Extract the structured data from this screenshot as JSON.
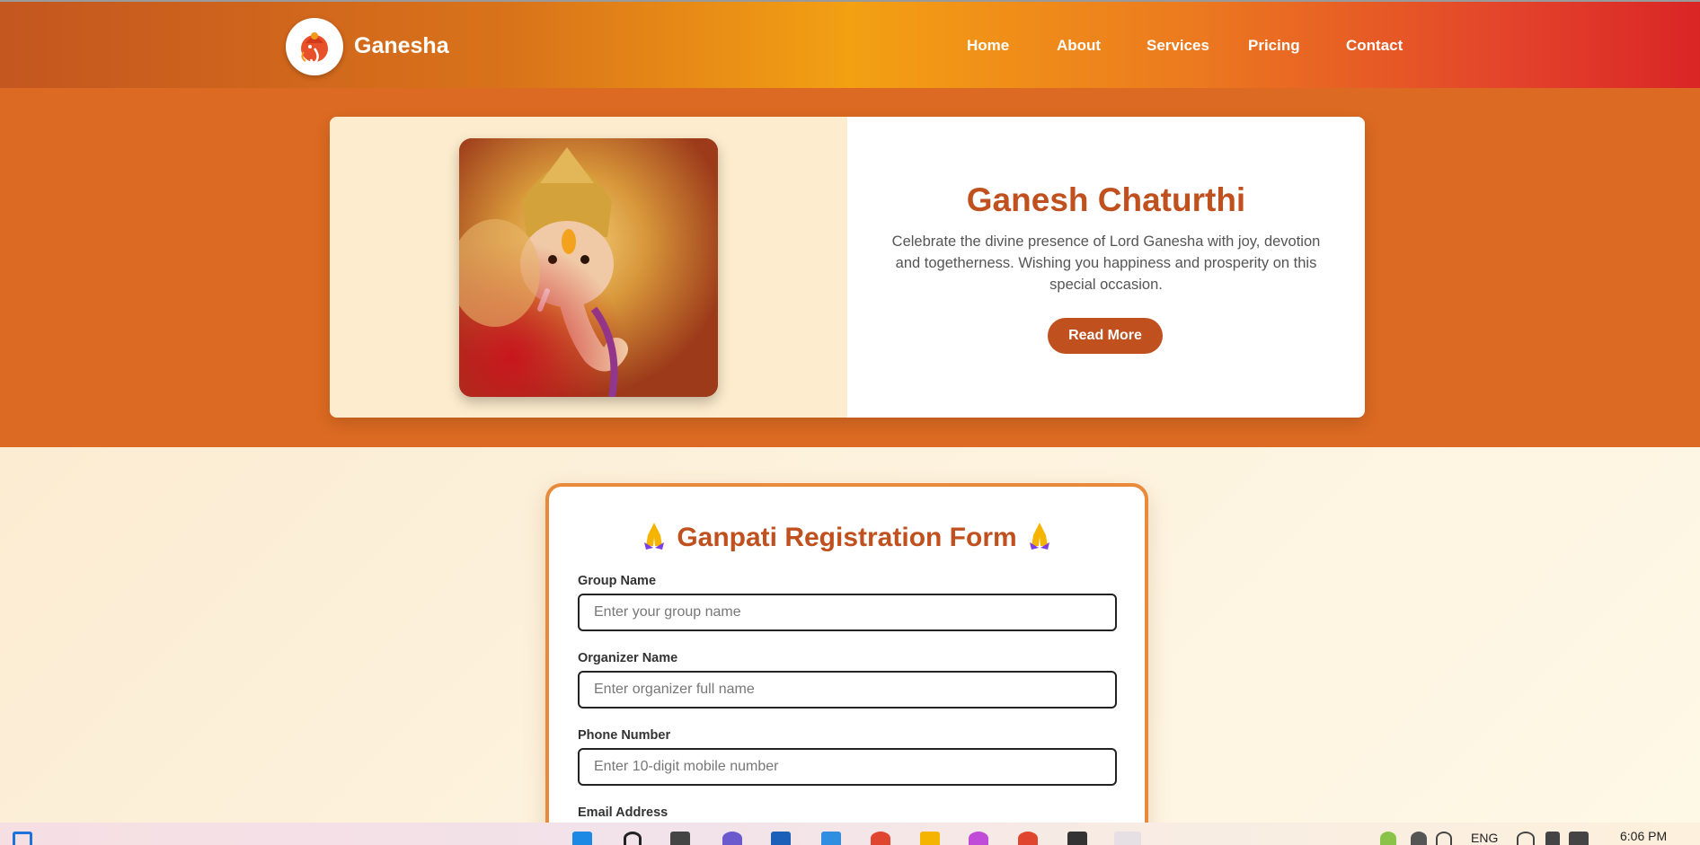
{
  "navbar": {
    "brand": "Ganesha",
    "links": [
      "Home",
      "About",
      "Services",
      "Pricing",
      "Contact"
    ]
  },
  "hero": {
    "title": "Ganesh Chaturthi",
    "text": "Celebrate the divine presence of Lord Ganesha with joy, devotion and togetherness. Wishing you happiness and prosperity on this special occasion.",
    "button": "Read More"
  },
  "form": {
    "title": "Ganpati Registration Form",
    "fields": [
      {
        "label": "Group Name",
        "placeholder": "Enter your group name"
      },
      {
        "label": "Organizer Name",
        "placeholder": "Enter organizer full name"
      },
      {
        "label": "Phone Number",
        "placeholder": "Enter 10-digit mobile number"
      },
      {
        "label": "Email Address",
        "placeholder": ""
      }
    ]
  },
  "taskbar": {
    "language": "ENG",
    "time": "6:06 PM"
  },
  "colors": {
    "accent": "#c0501e",
    "hero_band": "#dc6a22",
    "form_border": "#e9893a"
  }
}
